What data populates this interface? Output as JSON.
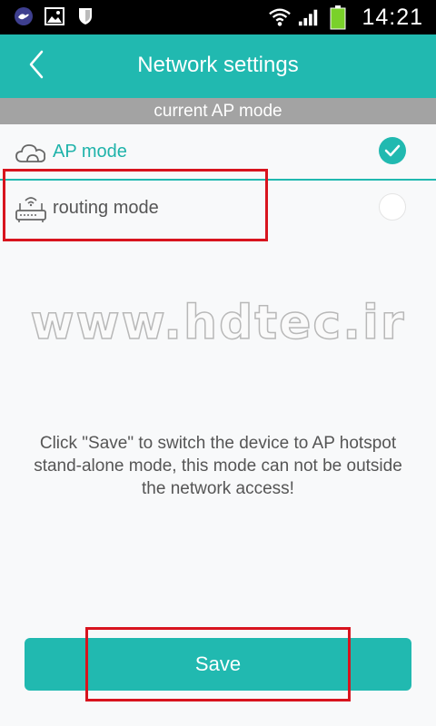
{
  "status_bar": {
    "time": "14:21",
    "left_icons": [
      "app-notification-icon",
      "image-notification-icon",
      "shield-icon"
    ],
    "right_icons": [
      "wifi-icon",
      "signal-icon",
      "battery-icon"
    ],
    "battery_color": "#7ad12a"
  },
  "header": {
    "title": "Network settings",
    "back_icon": "chevron-left-icon"
  },
  "section": {
    "label": "current AP mode"
  },
  "modes": [
    {
      "label": "AP mode",
      "icon": "cloud-icon",
      "selected": true
    },
    {
      "label": "routing mode",
      "icon": "router-icon",
      "selected": false
    }
  ],
  "watermark": "www.hdtec.ir",
  "info_text": "Click \"Save\" to switch the device to AP hotspot stand-alone mode, this mode can not be outside the network access!",
  "actions": {
    "save_label": "Save"
  },
  "colors": {
    "accent": "#21b9b0",
    "section_gray": "#a3a3a3",
    "highlight_red": "#d8141e"
  }
}
